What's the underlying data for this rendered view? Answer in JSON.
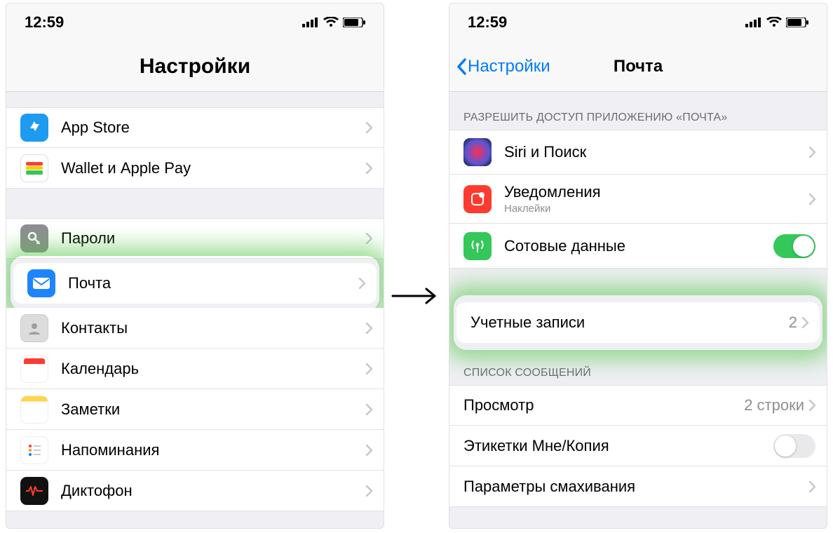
{
  "status": {
    "time": "12:59"
  },
  "left": {
    "title": "Настройки",
    "rows": {
      "appstore": "App Store",
      "wallet": "Wallet и Apple Pay",
      "passwords": "Пароли",
      "mail": "Почта",
      "contacts": "Контакты",
      "calendar": "Календарь",
      "notes": "Заметки",
      "reminders": "Напоминания",
      "voicememos": "Диктофон"
    }
  },
  "right": {
    "back": "Настройки",
    "title": "Почта",
    "section_allow": "РАЗРЕШИТЬ ДОСТУП ПРИЛОЖЕНИЮ «ПОЧТА»",
    "siri": "Siri и Поиск",
    "notifications": {
      "label": "Уведомления",
      "sub": "Наклейки"
    },
    "cellular": "Сотовые данные",
    "accounts": {
      "label": "Учетные записи",
      "count": "2"
    },
    "section_list": "СПИСОК СООБЩЕНИЙ",
    "preview": {
      "label": "Просмотр",
      "value": "2 строки"
    },
    "tome": "Этикетки Мне/Копия",
    "swipe": "Параметры смахивания"
  }
}
